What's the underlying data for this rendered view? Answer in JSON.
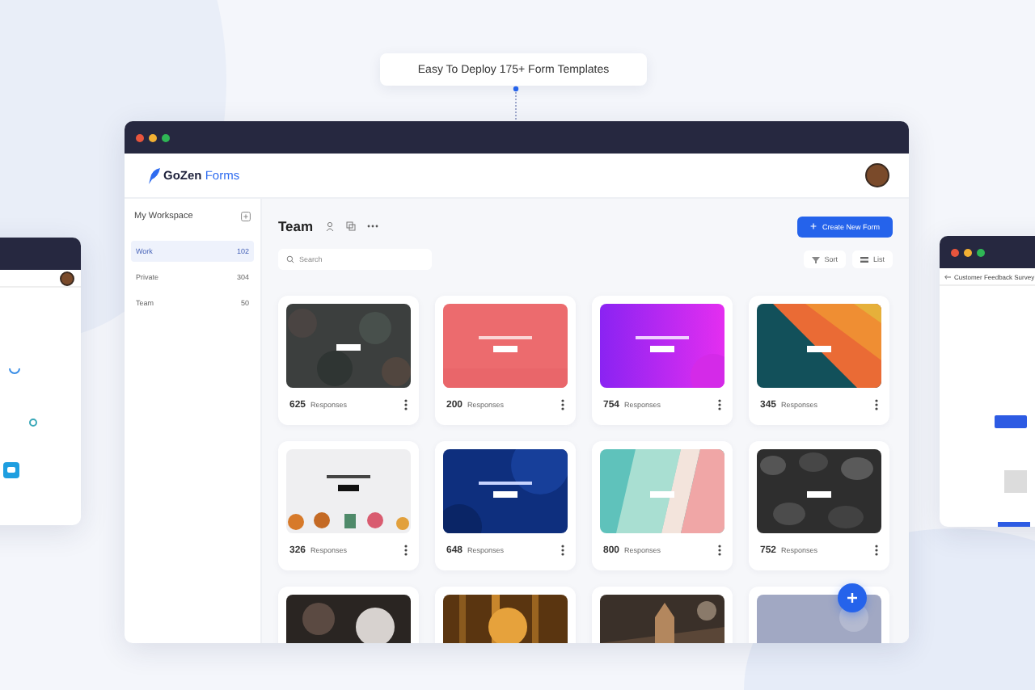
{
  "callout": {
    "text": "Easy To Deploy 175+ Form Templates"
  },
  "logo": {
    "brand": "GoZen",
    "product": "Forms"
  },
  "sidebar": {
    "title": "My Workspace",
    "items": [
      {
        "label": "Work",
        "count": "102",
        "selected": true
      },
      {
        "label": "Private",
        "count": "304",
        "selected": false
      },
      {
        "label": "Team",
        "count": "50",
        "selected": false
      }
    ]
  },
  "toolbar": {
    "title": "Team",
    "create_button": "Create New Form",
    "search": {
      "placeholder": "Search"
    },
    "sort": "Sort",
    "view": "List"
  },
  "cards": [
    {
      "kind": "form",
      "count": "625",
      "label": "Responses"
    },
    {
      "kind": "form",
      "count": "200",
      "label": "Responses"
    },
    {
      "kind": "form",
      "count": "754",
      "label": "Responses"
    },
    {
      "kind": "form",
      "count": "345",
      "label": "Responses"
    },
    {
      "kind": "form",
      "count": "326",
      "label": "Responses"
    },
    {
      "kind": "form",
      "count": "648",
      "label": "Responses"
    },
    {
      "kind": "form",
      "count": "800",
      "label": "Responses"
    },
    {
      "kind": "form",
      "count": "752",
      "label": "Responses"
    },
    {
      "kind": "picture"
    },
    {
      "kind": "picture"
    },
    {
      "kind": "picture"
    },
    {
      "kind": "picture"
    }
  ],
  "side_window": {
    "title": "Customer Feedback Survey"
  }
}
